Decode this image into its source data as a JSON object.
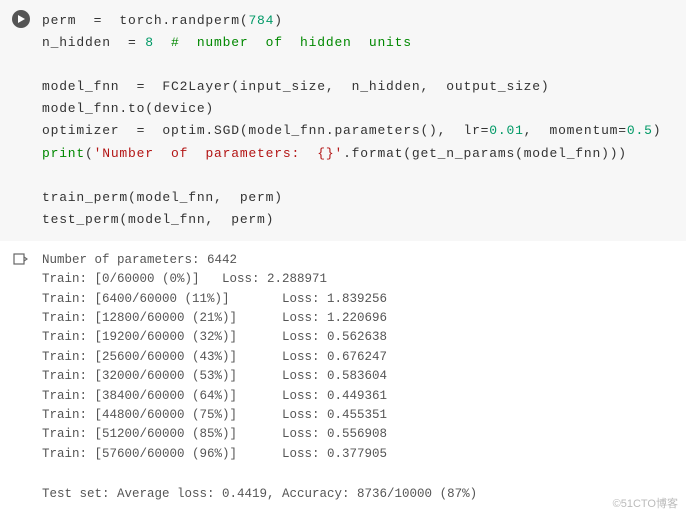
{
  "code": {
    "l1_a": "perm  =  torch.randperm(",
    "l1_b": "784",
    "l1_c": ")",
    "l2_a": "n_hidden  = ",
    "l2_b": "8",
    "l2_c": "  #  number  of  hidden  units",
    "l3_a": "model_fnn  =  FC2Layer(input_size,  n_hidden,  output_size)",
    "l4_a": "model_fnn.to(device)",
    "l5_a": "optimizer  =  optim.SGD(model_fnn.parameters(),  lr=",
    "l5_b": "0.01",
    "l5_c": ",  momentum=",
    "l5_d": "0.5",
    "l5_e": ")",
    "l6_a": "print",
    "l6_b": "(",
    "l6_c": "'Number  of  parameters:  {}'",
    "l6_d": ".format(get_n_params(model_fnn)))",
    "l7_a": "train_perm(model_fnn,  perm)",
    "l8_a": "test_perm(model_fnn,  perm)"
  },
  "output": {
    "params": "Number of parameters: 6442",
    "train_lines": [
      "Train: [0/60000 (0%)]   Loss: 2.288971",
      "Train: [6400/60000 (11%)]       Loss: 1.839256",
      "Train: [12800/60000 (21%)]      Loss: 1.220696",
      "Train: [19200/60000 (32%)]      Loss: 0.562638",
      "Train: [25600/60000 (43%)]      Loss: 0.676247",
      "Train: [32000/60000 (53%)]      Loss: 0.583604",
      "Train: [38400/60000 (64%)]      Loss: 0.449361",
      "Train: [44800/60000 (75%)]      Loss: 0.455351",
      "Train: [51200/60000 (85%)]      Loss: 0.556908",
      "Train: [57600/60000 (96%)]      Loss: 0.377905"
    ],
    "test_line": "Test set: Average loss: 0.4419, Accuracy: 8736/10000 (87%)"
  },
  "watermark": "©51CTO博客"
}
